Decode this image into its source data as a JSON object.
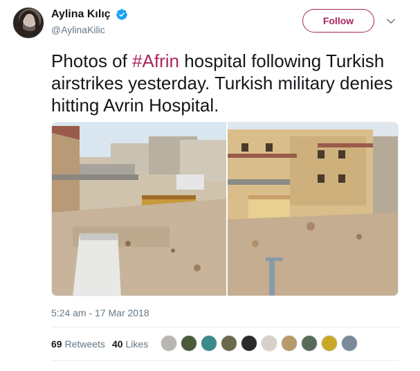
{
  "user": {
    "display_name": "Aylina Kılıç",
    "handle": "@AylinaKilic",
    "verified": true,
    "follow_label": "Follow",
    "accent_color": "#a8245e"
  },
  "tweet": {
    "text_before": "Photos of ",
    "hashtag": "#Afrin",
    "text_after": " hospital following Turkish airstrikes yesterday. Turkish military denies hitting Avrin Hospital.",
    "timestamp": "5:24 am - 17 Mar 2018"
  },
  "media": {
    "photos": [
      {
        "name": "photo-left",
        "icon": "photo-icon"
      },
      {
        "name": "photo-right",
        "icon": "photo-icon"
      }
    ]
  },
  "stats": {
    "retweets_count": "69",
    "retweets_label": "Retweets",
    "likes_count": "40",
    "likes_label": "Likes"
  },
  "likers": [
    {
      "color": "#b9b6b2"
    },
    {
      "color": "#4a5a3a"
    },
    {
      "color": "#3a8a8a"
    },
    {
      "color": "#6a6a4a"
    },
    {
      "color": "#2a2a2a"
    },
    {
      "color": "#d8d0c8"
    },
    {
      "color": "#b89a6a"
    },
    {
      "color": "#5a6a5a"
    },
    {
      "color": "#c8a82a"
    },
    {
      "color": "#7a8a9a"
    }
  ]
}
